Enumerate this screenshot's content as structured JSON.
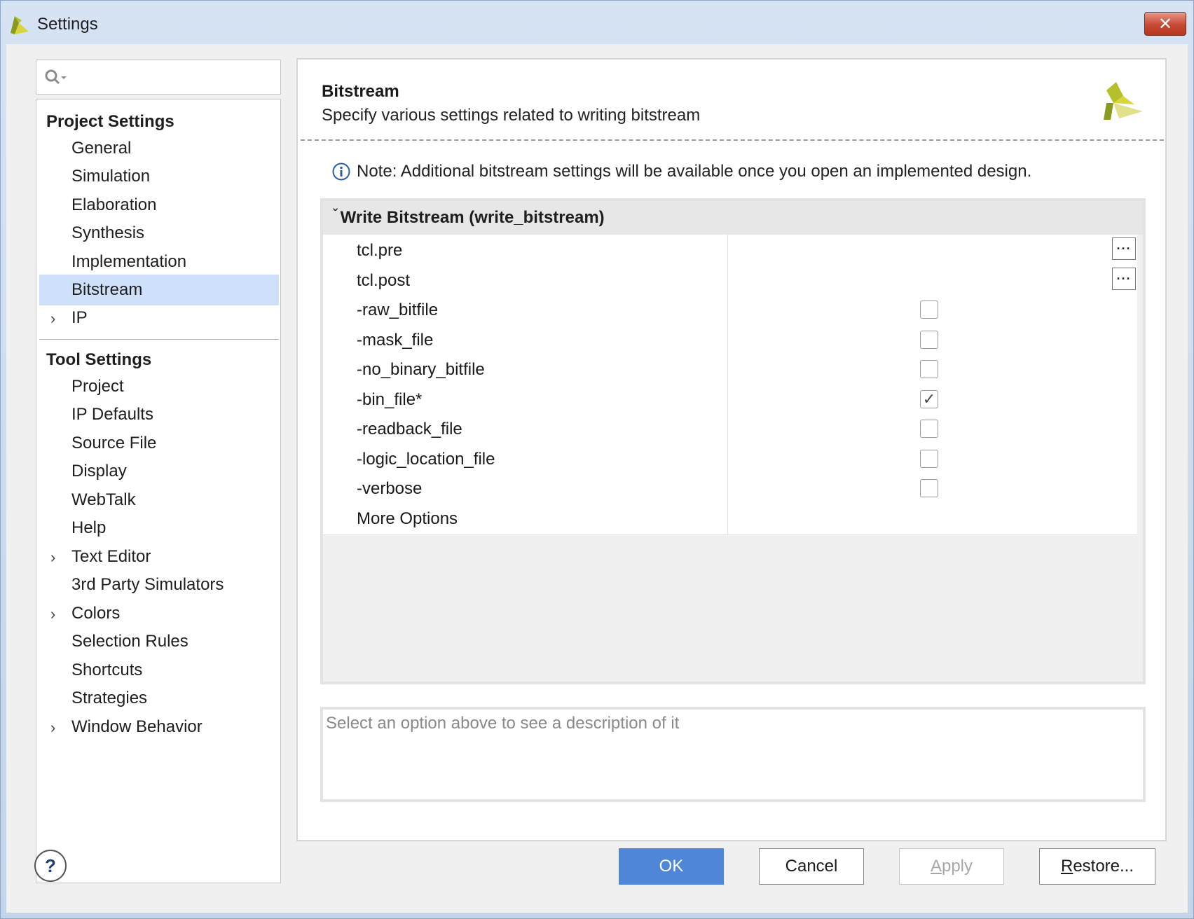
{
  "window": {
    "title": "Settings",
    "close_label": "✕"
  },
  "search": {
    "placeholder": ""
  },
  "sidebar": {
    "project_heading": "Project Settings",
    "project_items": [
      {
        "label": "General",
        "selected": false,
        "expandable": false
      },
      {
        "label": "Simulation",
        "selected": false,
        "expandable": false
      },
      {
        "label": "Elaboration",
        "selected": false,
        "expandable": false
      },
      {
        "label": "Synthesis",
        "selected": false,
        "expandable": false
      },
      {
        "label": "Implementation",
        "selected": false,
        "expandable": false
      },
      {
        "label": "Bitstream",
        "selected": true,
        "expandable": false
      },
      {
        "label": "IP",
        "selected": false,
        "expandable": true
      }
    ],
    "tool_heading": "Tool Settings",
    "tool_items": [
      {
        "label": "Project",
        "expandable": false
      },
      {
        "label": "IP Defaults",
        "expandable": false
      },
      {
        "label": "Source File",
        "expandable": false
      },
      {
        "label": "Display",
        "expandable": false
      },
      {
        "label": "WebTalk",
        "expandable": false
      },
      {
        "label": "Help",
        "expandable": false
      },
      {
        "label": "Text Editor",
        "expandable": true
      },
      {
        "label": "3rd Party Simulators",
        "expandable": false
      },
      {
        "label": "Colors",
        "expandable": true
      },
      {
        "label": "Selection Rules",
        "expandable": false
      },
      {
        "label": "Shortcuts",
        "expandable": false
      },
      {
        "label": "Strategies",
        "expandable": false
      },
      {
        "label": "Window Behavior",
        "expandable": true
      }
    ]
  },
  "main": {
    "title": "Bitstream",
    "subtitle": "Specify various settings related to writing bitstream",
    "note": "Note: Additional bitstream settings will be available once you open an implemented design.",
    "group_label": "Write Bitstream (write_bitstream)",
    "rows": [
      {
        "name": "tcl.pre",
        "kind": "ellipsis",
        "checked": false
      },
      {
        "name": "tcl.post",
        "kind": "ellipsis",
        "checked": false
      },
      {
        "name": "-raw_bitfile",
        "kind": "checkbox",
        "checked": false
      },
      {
        "name": "-mask_file",
        "kind": "checkbox",
        "checked": false
      },
      {
        "name": "-no_binary_bitfile",
        "kind": "checkbox",
        "checked": false
      },
      {
        "name": "-bin_file*",
        "kind": "checkbox",
        "checked": true
      },
      {
        "name": "-readback_file",
        "kind": "checkbox",
        "checked": false
      },
      {
        "name": "-logic_location_file",
        "kind": "checkbox",
        "checked": false
      },
      {
        "name": "-verbose",
        "kind": "checkbox",
        "checked": false
      },
      {
        "name": "More Options",
        "kind": "text",
        "checked": false
      }
    ],
    "ellipsis_label": "···",
    "description_placeholder": "Select an option above to see a description of it"
  },
  "footer": {
    "help_label": "?",
    "ok_label": "OK",
    "cancel_label": "Cancel",
    "apply_mnemonic": "A",
    "apply_rest": "pply",
    "restore_mnemonic": "R",
    "restore_rest": "estore..."
  },
  "colors": {
    "selection": "#cfe0fb",
    "primary_button": "#4f86d8",
    "brand_yellow": "#d8d63a",
    "brand_olive": "#8a9a1e"
  }
}
